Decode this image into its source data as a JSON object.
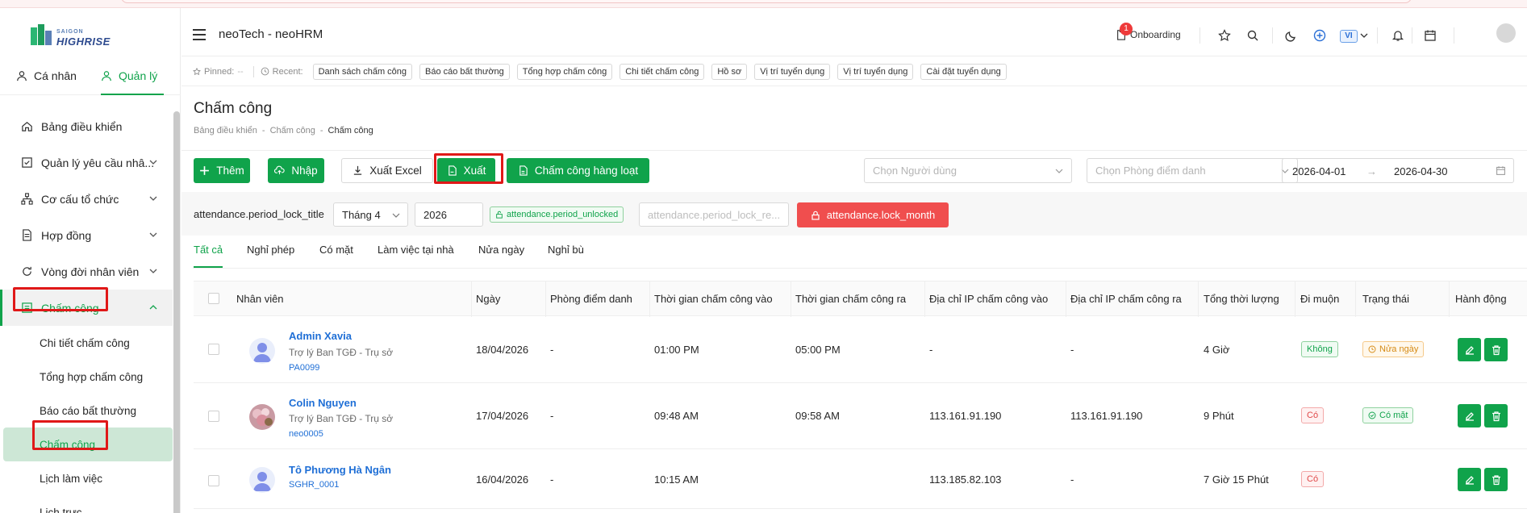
{
  "brand": {
    "line1": "SAIGON",
    "line2": "HIGHRISE"
  },
  "sidebar": {
    "roles": [
      {
        "label": "Cá nhân"
      },
      {
        "label": "Quản lý"
      }
    ],
    "items": [
      {
        "label": "Bảng điều khiển"
      },
      {
        "label": "Quản lý yêu cầu nhâ..."
      },
      {
        "label": "Cơ cấu tổ chức"
      },
      {
        "label": "Hợp đồng"
      },
      {
        "label": "Vòng đời nhân viên"
      },
      {
        "label": "Chấm công"
      }
    ],
    "subitems": [
      {
        "label": "Chi tiết chấm công"
      },
      {
        "label": "Tổng hợp chấm công"
      },
      {
        "label": "Báo cáo bất thường"
      },
      {
        "label": "Chấm công"
      },
      {
        "label": "Lịch làm việc"
      },
      {
        "label": "Lịch trực"
      }
    ]
  },
  "header": {
    "title": "neoTech - neoHRM",
    "onboarding_label": "Onboarding",
    "onboarding_count": "1",
    "lang": "VI"
  },
  "recent": {
    "pinned_label": "Pinned:",
    "pinned_value": "--",
    "recent_label": "Recent:",
    "chips": [
      "Danh sách chấm công",
      "Báo cáo bất thường",
      "Tổng hợp chấm công",
      "Chi tiết chấm công",
      "Hồ sơ",
      "Vị trí tuyển dụng",
      "Vị trí tuyển dụng",
      "Cài đặt tuyển dụng"
    ]
  },
  "page": {
    "title": "Chấm công",
    "breadcrumb": [
      "Bảng điều khiển",
      "Chấm công",
      "Chấm công"
    ]
  },
  "actions": {
    "add": "Thêm",
    "import": "Nhập",
    "export_excel": "Xuất Excel",
    "export": "Xuất",
    "bulk": "Chấm công hàng loạt",
    "user_placeholder": "Chọn Người dùng",
    "room_placeholder": "Chọn Phòng điểm danh",
    "date_from": "2026-04-01",
    "date_to": "2026-04-30"
  },
  "lock": {
    "title": "attendance.period_lock_title",
    "month": "Tháng 4",
    "year": "2026",
    "status": "attendance.period_unlocked",
    "reason_placeholder": "attendance.period_lock_re...",
    "lock_button": "attendance.lock_month"
  },
  "tabs": [
    "Tất cả",
    "Nghỉ phép",
    "Có mặt",
    "Làm việc tại nhà",
    "Nửa ngày",
    "Nghỉ bù"
  ],
  "table": {
    "headers": [
      "Nhân viên",
      "Ngày",
      "Phòng điểm danh",
      "Thời gian chấm công vào",
      "Thời gian chấm công ra",
      "Địa chỉ IP chấm công vào",
      "Địa chỉ IP chấm công ra",
      "Tổng thời lượng",
      "Đi muộn",
      "Trạng thái",
      "Hành động"
    ],
    "rows": [
      {
        "name": "Admin Xavia",
        "position": "Trợ lý Ban TGĐ - Trụ sở",
        "code": "PA0099",
        "date": "18/04/2026",
        "room": "-",
        "in": "01:00 PM",
        "out": "05:00 PM",
        "ip_in": "-",
        "ip_out": "-",
        "total": "4 Giờ",
        "late": "Không",
        "status": "Nửa ngày"
      },
      {
        "name": "Colin Nguyen",
        "position": "Trợ lý Ban TGĐ - Trụ sở",
        "code": "neo0005",
        "date": "17/04/2026",
        "room": "-",
        "in": "09:48 AM",
        "out": "09:58 AM",
        "ip_in": "113.161.91.190",
        "ip_out": "113.161.91.190",
        "total": "9 Phút",
        "late": "Có",
        "status": "Có mặt"
      },
      {
        "name": "Tô Phương Hà Ngân",
        "position": "",
        "code": "SGHR_0001",
        "date": "16/04/2026",
        "room": "-",
        "in": "10:15 AM",
        "out": "",
        "ip_in": "113.185.82.103",
        "ip_out": "-",
        "total": "7 Giờ 15 Phút",
        "late": "Có",
        "status": ""
      }
    ]
  },
  "colors": {
    "primary": "#10a34b",
    "danger": "#f04e4e",
    "link": "#1f6fd6"
  }
}
